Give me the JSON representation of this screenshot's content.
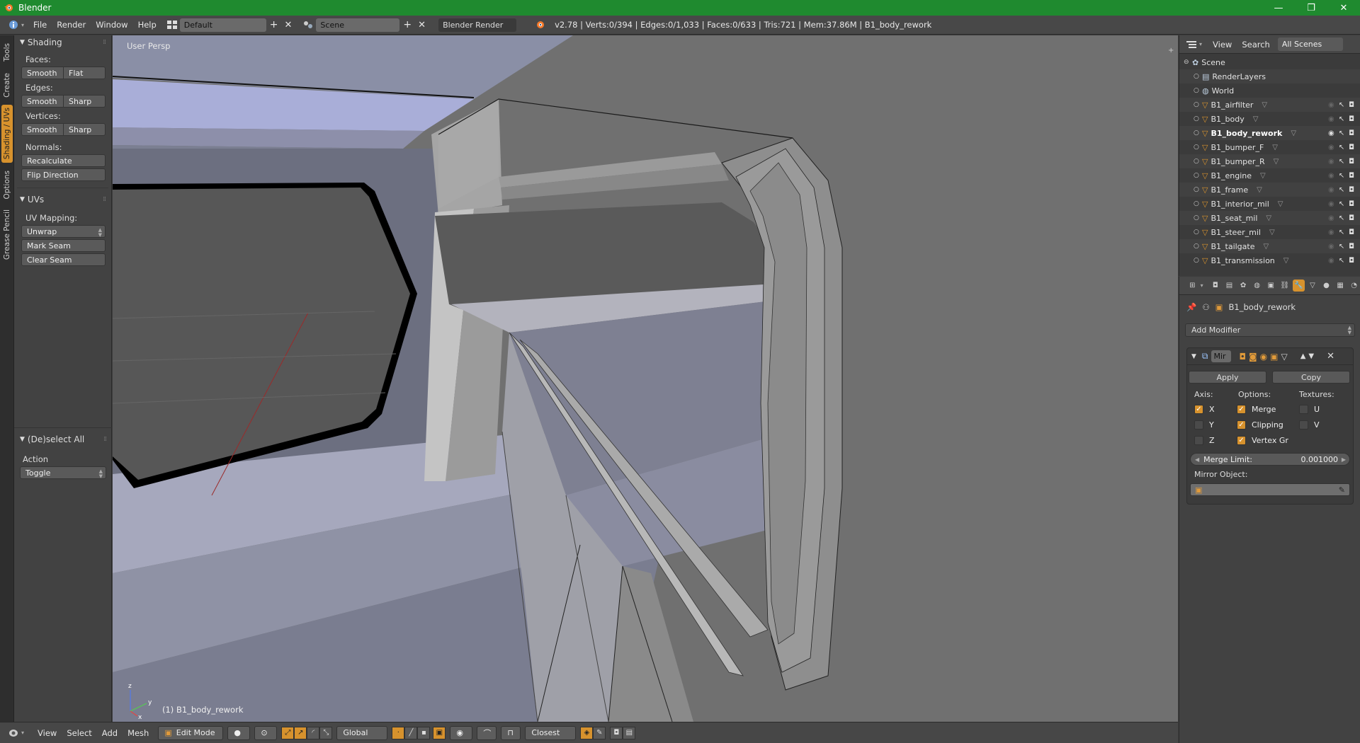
{
  "window": {
    "title": "Blender",
    "controls": [
      "—",
      "❐",
      "✕"
    ]
  },
  "infobar": {
    "menus": [
      "File",
      "Render",
      "Window",
      "Help"
    ],
    "layout": "Default",
    "scene": "Scene",
    "render_engine": "Blender Render",
    "stats": "v2.78 | Verts:0/394 | Edges:0/1,033 | Faces:0/633 | Tris:721 | Mem:37.86M | B1_body_rework"
  },
  "tabstrip": {
    "tabs": [
      "Tools",
      "Create",
      "Shading / UVs",
      "Options",
      "Grease Pencil"
    ],
    "active": "Shading / UVs"
  },
  "toolshelf": {
    "shading": {
      "title": "Shading",
      "faces_label": "Faces:",
      "faces_buttons": [
        "Smooth",
        "Flat"
      ],
      "edges_label": "Edges:",
      "edges_buttons": [
        "Smooth",
        "Sharp"
      ],
      "vertices_label": "Vertices:",
      "vertices_buttons": [
        "Smooth",
        "Sharp"
      ],
      "normals_label": "Normals:",
      "recalculate": "Recalculate",
      "flip_direction": "Flip Direction"
    },
    "uvs": {
      "title": "UVs",
      "uv_mapping_label": "UV Mapping:",
      "unwrap": "Unwrap",
      "mark_seam": "Mark Seam",
      "clear_seam": "Clear Seam"
    },
    "operator": {
      "title": "(De)select All",
      "action_label": "Action",
      "action_value": "Toggle"
    }
  },
  "viewport": {
    "view_label": "User Persp",
    "object_label": "(1) B1_body_rework"
  },
  "bottombar": {
    "menus": [
      "View",
      "Select",
      "Add",
      "Mesh"
    ],
    "mode": "Edit Mode",
    "orientation": "Global",
    "snap_target": "Closest"
  },
  "outliner": {
    "header": {
      "view": "View",
      "search": "Search",
      "filter": "All Scenes"
    },
    "rows": [
      {
        "name": "Scene",
        "indent": 0,
        "kind": "scene"
      },
      {
        "name": "RenderLayers",
        "indent": 1,
        "kind": "renderlayers"
      },
      {
        "name": "World",
        "indent": 1,
        "kind": "world"
      },
      {
        "name": "B1_airfilter",
        "indent": 1,
        "kind": "mesh"
      },
      {
        "name": "B1_body",
        "indent": 1,
        "kind": "mesh"
      },
      {
        "name": "B1_body_rework",
        "indent": 1,
        "kind": "mesh",
        "selected": true
      },
      {
        "name": "B1_bumper_F",
        "indent": 1,
        "kind": "mesh"
      },
      {
        "name": "B1_bumper_R",
        "indent": 1,
        "kind": "mesh"
      },
      {
        "name": "B1_engine",
        "indent": 1,
        "kind": "mesh"
      },
      {
        "name": "B1_frame",
        "indent": 1,
        "kind": "mesh"
      },
      {
        "name": "B1_interior_mil",
        "indent": 1,
        "kind": "mesh"
      },
      {
        "name": "B1_seat_mil",
        "indent": 1,
        "kind": "mesh"
      },
      {
        "name": "B1_steer_mil",
        "indent": 1,
        "kind": "mesh"
      },
      {
        "name": "B1_tailgate",
        "indent": 1,
        "kind": "mesh"
      },
      {
        "name": "B1_transmission",
        "indent": 1,
        "kind": "mesh"
      }
    ]
  },
  "properties": {
    "object_name": "B1_body_rework",
    "add_modifier": "Add Modifier",
    "modifier": {
      "name": "Mir",
      "apply": "Apply",
      "copy": "Copy",
      "axis_label": "Axis:",
      "options_label": "Options:",
      "textures_label": "Textures:",
      "axis": [
        {
          "label": "X",
          "on": true
        },
        {
          "label": "Y",
          "on": false
        },
        {
          "label": "Z",
          "on": false
        }
      ],
      "options": [
        {
          "label": "Merge",
          "on": true
        },
        {
          "label": "Clipping",
          "on": true
        },
        {
          "label": "Vertex Gr",
          "on": true
        }
      ],
      "textures": [
        {
          "label": "U",
          "on": false
        },
        {
          "label": "V",
          "on": false
        }
      ],
      "merge_limit_label": "Merge Limit:",
      "merge_limit_value": "0.001000",
      "mirror_object_label": "Mirror Object:"
    }
  },
  "colors": {
    "titlebar": "#1f8a2f",
    "accent": "#d7922d",
    "viewport_bg": "#6f6f6f",
    "panel_bg": "#424242"
  }
}
